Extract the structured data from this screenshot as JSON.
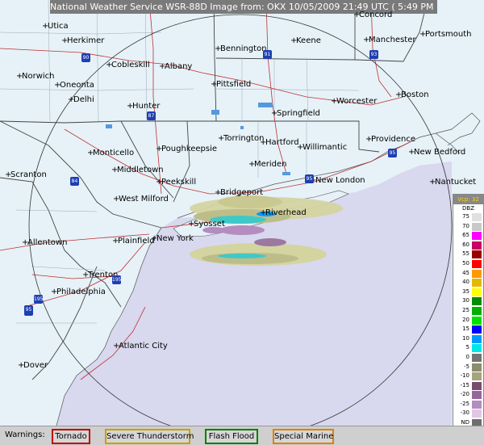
{
  "header": {
    "title": "National Weather Service WSR-88D Image from: OKX 10/05/2009 21:49 UTC ( 5:49 PM EDT)"
  },
  "cities": [
    {
      "name": "Concord"
    },
    {
      "name": "Utica"
    },
    {
      "name": "Herkimer"
    },
    {
      "name": "Bennington"
    },
    {
      "name": "Keene"
    },
    {
      "name": "Manchester"
    },
    {
      "name": "Portsmouth"
    },
    {
      "name": "Cobleskill"
    },
    {
      "name": "Albany"
    },
    {
      "name": "Norwich"
    },
    {
      "name": "Oneonta"
    },
    {
      "name": "Pittsfield"
    },
    {
      "name": "Boston"
    },
    {
      "name": "Delhi"
    },
    {
      "name": "Hunter"
    },
    {
      "name": "Worcester"
    },
    {
      "name": "Springfield"
    },
    {
      "name": "Torrington"
    },
    {
      "name": "Providence"
    },
    {
      "name": "Hartford"
    },
    {
      "name": "Monticello"
    },
    {
      "name": "Poughkeepsie"
    },
    {
      "name": "Willimantic"
    },
    {
      "name": "New Bedford"
    },
    {
      "name": "Middletown"
    },
    {
      "name": "Meriden"
    },
    {
      "name": "Scranton"
    },
    {
      "name": "Peekskill"
    },
    {
      "name": "New London"
    },
    {
      "name": "Nantucket"
    },
    {
      "name": "Bridgeport"
    },
    {
      "name": "West Milford"
    },
    {
      "name": "Riverhead"
    },
    {
      "name": "Syosset"
    },
    {
      "name": "Allentown"
    },
    {
      "name": "Plainfield"
    },
    {
      "name": "New York"
    },
    {
      "name": "Trenton"
    },
    {
      "name": "Philadelphia"
    },
    {
      "name": "Atlantic City"
    },
    {
      "name": "Dover"
    }
  ],
  "interstates": [
    "90",
    "91",
    "93",
    "87",
    "84",
    "95",
    "95",
    "195",
    "195",
    "76",
    "95"
  ],
  "legend": {
    "header": "Vcp: 32",
    "unit": "DBZ",
    "rows": [
      {
        "label": "75",
        "color": "#e0e0e0"
      },
      {
        "label": "70",
        "color": "#c8c8c8"
      },
      {
        "label": "65",
        "color": "#ff00ff"
      },
      {
        "label": "60",
        "color": "#c80064"
      },
      {
        "label": "55",
        "color": "#9b0000"
      },
      {
        "label": "50",
        "color": "#ff0000"
      },
      {
        "label": "45",
        "color": "#ff9900"
      },
      {
        "label": "40",
        "color": "#e5b800"
      },
      {
        "label": "35",
        "color": "#ffff00"
      },
      {
        "label": "30",
        "color": "#008c00"
      },
      {
        "label": "25",
        "color": "#00b000"
      },
      {
        "label": "20",
        "color": "#00e000"
      },
      {
        "label": "15",
        "color": "#0000ff"
      },
      {
        "label": "10",
        "color": "#0099ff"
      },
      {
        "label": "5",
        "color": "#00e6e6"
      },
      {
        "label": "0",
        "color": "#737373"
      },
      {
        "label": "-5",
        "color": "#8c8c6e"
      },
      {
        "label": "-10",
        "color": "#a5a57d"
      },
      {
        "label": "-15",
        "color": "#7a4a6e"
      },
      {
        "label": "-20",
        "color": "#95689a"
      },
      {
        "label": "-25",
        "color": "#b48cc0"
      },
      {
        "label": "-30",
        "color": "#e1c6e6"
      },
      {
        "label": "ND",
        "color": "#6e6e6e"
      }
    ]
  },
  "warnings": {
    "label": "Warnings:",
    "buttons": [
      {
        "label": "Tornado",
        "color": "#c00000"
      },
      {
        "label": "Severe Thunderstorm",
        "color": "#c8a000"
      },
      {
        "label": "Flash Flood",
        "color": "#008000"
      },
      {
        "label": "Special Marine",
        "color": "#e08000"
      }
    ]
  }
}
